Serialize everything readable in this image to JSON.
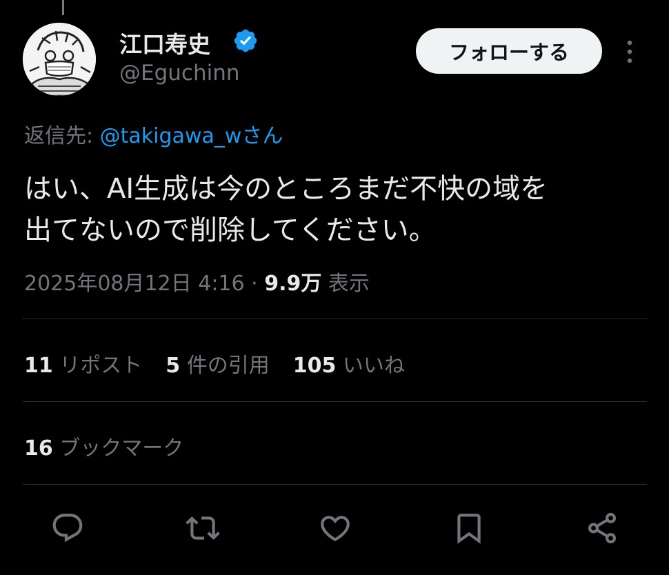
{
  "author": {
    "display_name": "江口寿史",
    "handle": "@Eguchinn",
    "verified": true
  },
  "follow_button": {
    "label": "フォローする"
  },
  "reply_to": {
    "prefix": "返信先:",
    "mention": "@takigawa_wさん"
  },
  "tweet": {
    "line1": "はい、AI生成は今のところまだ不快の域を",
    "line2": "出てないので削除してください。"
  },
  "meta": {
    "timestamp": "2025年08月12日 4:16",
    "separator": " · ",
    "views_count": "9.9万",
    "views_label": "表示"
  },
  "stats": {
    "reposts_count": "11",
    "reposts_label": "リポスト",
    "quotes_count": "5",
    "quotes_label": "件の引用",
    "likes_count": "105",
    "likes_label": "いいね"
  },
  "bookmarks": {
    "count": "16",
    "label": "ブックマーク"
  },
  "colors": {
    "background": "#000000",
    "text_primary": "#e7e9ea",
    "text_secondary": "#71767b",
    "accent": "#1d9bf0",
    "divider": "#2f3336",
    "follow_bg": "#eff3f4"
  },
  "icons": [
    "reply-icon",
    "repost-icon",
    "like-icon",
    "bookmark-icon",
    "share-icon",
    "more-icon",
    "verified-icon"
  ]
}
